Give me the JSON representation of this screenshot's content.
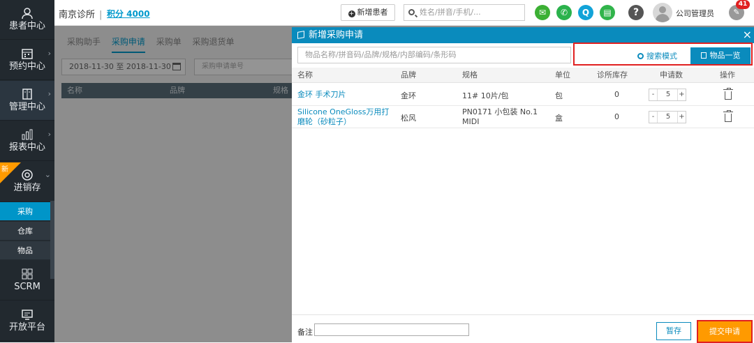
{
  "sidebar": {
    "items": [
      {
        "label": "患者中心",
        "icon": "user-icon"
      },
      {
        "label": "预约中心",
        "icon": "calendar-icon"
      },
      {
        "label": "管理中心",
        "icon": "book-icon"
      },
      {
        "label": "报表中心",
        "icon": "bar-chart-icon"
      },
      {
        "label": "进销存",
        "icon": "lifebuoy-icon"
      },
      {
        "label": "SCRM",
        "icon": "grid-icon"
      },
      {
        "label": "开放平台",
        "icon": "monitor-icon"
      }
    ],
    "new_badge": "新",
    "subitems": [
      "采购",
      "仓库",
      "物品"
    ]
  },
  "header": {
    "clinic": "南京诊所",
    "points": "积分 4000",
    "new_patient": "新增患者",
    "search_placeholder": "姓名/拼音/手机/...",
    "user": "公司管理员",
    "bell_count": "41",
    "help": "?"
  },
  "background": {
    "tabs": [
      "采购助手",
      "采购申请",
      "采购单",
      "采购退货单"
    ],
    "date_range": "2018-11-30 至 2018-11-30",
    "number_placeholder": "采购申请单号",
    "columns": [
      "名称",
      "品牌",
      "规格"
    ]
  },
  "modal": {
    "title": "新增采购申请",
    "close": "×",
    "search_placeholder": "物品名称/拼音码/品牌/规格/内部编码/条形码",
    "search_mode": "搜索模式",
    "item_list": "物品一览",
    "columns": [
      "名称",
      "品牌",
      "规格",
      "单位",
      "诊所库存",
      "申请数",
      "操作"
    ],
    "rows": [
      {
        "name": "金环 手术刀片",
        "brand": "金环",
        "spec": "11# 10片/包",
        "unit": "包",
        "stock": "0",
        "qty": "5"
      },
      {
        "name": "Silicone OneGloss万用打磨轮（砂粒子）",
        "brand": "松风",
        "spec": "PN0171 小包装 No.1 MIDI",
        "unit": "盒",
        "stock": "0",
        "qty": "5"
      }
    ],
    "minus": "-",
    "plus": "+",
    "note_label": "备注",
    "save": "暂存",
    "submit": "提交申请"
  },
  "colors": {
    "accent": "#0a8bbd",
    "sidebar": "#22292f",
    "submit": "#ff9a00",
    "highlight": "#e02020"
  }
}
